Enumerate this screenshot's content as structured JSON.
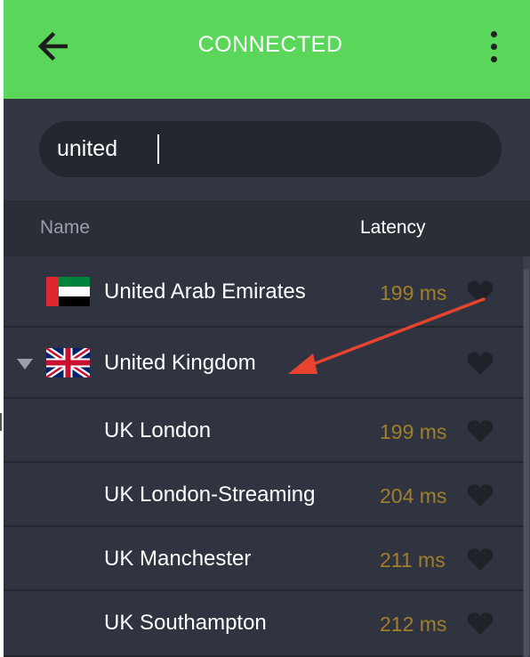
{
  "header": {
    "title": "CONNECTED",
    "background_color": "#5ad65a",
    "back_icon": "arrow-left-icon",
    "menu_icon": "kebab-menu-icon"
  },
  "search": {
    "value": "united",
    "placeholder": ""
  },
  "columns": {
    "name": "Name",
    "latency": "Latency"
  },
  "rows": [
    {
      "type": "country",
      "label": "United Arab Emirates",
      "flag": "uae-flag-icon",
      "latency": "199 ms",
      "favorite_icon": "heart-icon"
    },
    {
      "type": "country",
      "label": "United Kingdom",
      "flag": "uk-flag-icon",
      "latency": "",
      "favorite_icon": "heart-icon",
      "expanded": true
    },
    {
      "type": "server",
      "label": "UK London",
      "latency": "199 ms",
      "favorite_icon": "heart-icon"
    },
    {
      "type": "server",
      "label": "UK London-Streaming",
      "latency": "204 ms",
      "favorite_icon": "heart-icon"
    },
    {
      "type": "server",
      "label": "UK Manchester",
      "latency": "211 ms",
      "favorite_icon": "heart-icon"
    },
    {
      "type": "server",
      "label": "UK Southampton",
      "latency": "212 ms",
      "favorite_icon": "heart-icon"
    }
  ],
  "colors": {
    "latency_text": "#a07f2a",
    "list_background": "#2f3440",
    "annotation_arrow": "#e8432e"
  }
}
